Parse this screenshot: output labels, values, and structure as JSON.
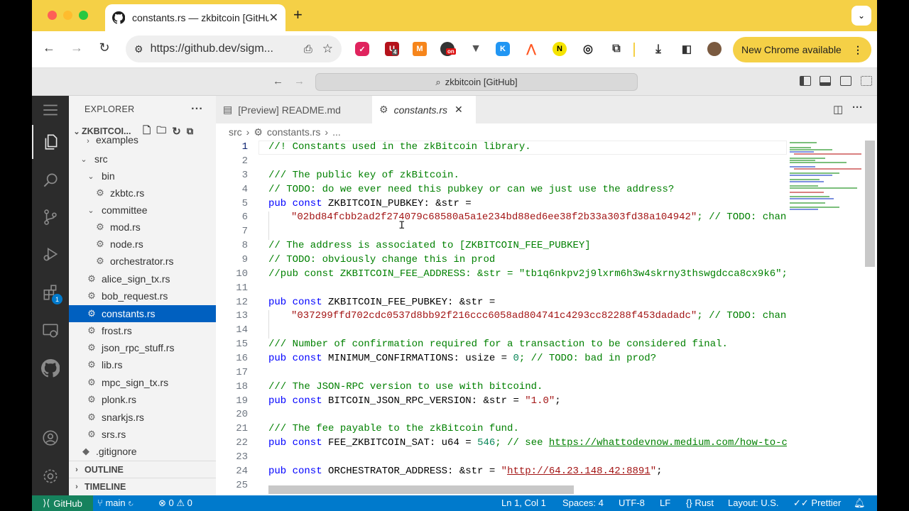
{
  "browser": {
    "tab_title": "constants.rs — zkbitcoin [GitHub]",
    "url": "https://github.dev/sigm...",
    "new_chrome": "New Chrome available",
    "ext_badge_1": "4",
    "ext_badge_2": "on"
  },
  "vscode": {
    "command_center": "zkbitcoin [GitHub]",
    "explorer_title": "EXPLORER",
    "root_folder": "ZKBITCOI...",
    "tree": [
      {
        "label": "examples",
        "kind": "folder"
      },
      {
        "label": "src",
        "kind": "folder"
      },
      {
        "label": "bin",
        "kind": "folder"
      },
      {
        "label": "zkbtc.rs",
        "kind": "file"
      },
      {
        "label": "committee",
        "kind": "folder"
      },
      {
        "label": "mod.rs",
        "kind": "file"
      },
      {
        "label": "node.rs",
        "kind": "file"
      },
      {
        "label": "orchestrator.rs",
        "kind": "file"
      },
      {
        "label": "alice_sign_tx.rs",
        "kind": "file"
      },
      {
        "label": "bob_request.rs",
        "kind": "file"
      },
      {
        "label": "constants.rs",
        "kind": "file"
      },
      {
        "label": "frost.rs",
        "kind": "file"
      },
      {
        "label": "json_rpc_stuff.rs",
        "kind": "file"
      },
      {
        "label": "lib.rs",
        "kind": "file"
      },
      {
        "label": "mpc_sign_tx.rs",
        "kind": "file"
      },
      {
        "label": "plonk.rs",
        "kind": "file"
      },
      {
        "label": "snarkjs.rs",
        "kind": "file"
      },
      {
        "label": "srs.rs",
        "kind": "file"
      },
      {
        "label": ".gitignore",
        "kind": "file"
      }
    ],
    "outline": "OUTLINE",
    "timeline": "TIMELINE",
    "extensions_badge": "1",
    "tabs": [
      {
        "label": "[Preview] README.md"
      },
      {
        "label": "constants.rs"
      }
    ],
    "breadcrumb": {
      "seg1": "src",
      "seg2": "constants.rs",
      "seg3": "..."
    },
    "line_numbers": [
      "1",
      "2",
      "3",
      "4",
      "5",
      "6",
      "7",
      "8",
      "9",
      "10",
      "11",
      "12",
      "13",
      "14",
      "15",
      "16",
      "17",
      "18",
      "19",
      "20",
      "21",
      "22",
      "23",
      "24",
      "25"
    ],
    "code": {
      "l1": "//! Constants used in the zkBitcoin library.",
      "l3": "/// The public key of zkBitcoin.",
      "l4": "// TODO: do we ever need this pubkey or can we just use the address?",
      "l5_kw": "pub const",
      "l5_rest": " ZKBITCOIN_PUBKEY: &str =",
      "l6_str": "\"02bd84fcbb2ad2f274079c68580a5a1e234bd88ed6ee38f2b33a303fd38a104942\"",
      "l6_cm": "; // TODO: change th",
      "l8": "// The address is associated to [ZKBITCOIN_FEE_PUBKEY]",
      "l9": "// TODO: obviously change this in prod",
      "l10": "//pub const ZKBITCOIN_FEE_ADDRESS: &str = \"tb1q6nkpv2j9lxrm6h3w4skrny3thswgdcca8cx9k6\";",
      "l12_kw": "pub const",
      "l12_rest": " ZKBITCOIN_FEE_PUBKEY: &str =",
      "l13_str": "\"037299ffd702cdc0537d8bb92f216ccc6058ad804741c4293cc82288f453dadadc\"",
      "l13_cm": "; // TODO: change th",
      "l15": "/// Number of confirmation required for a transaction to be considered final.",
      "l16_kw": "pub const",
      "l16_rest": " MINIMUM_CONFIRMATIONS: usize = ",
      "l16_num": "0",
      "l16_cm": "; // TODO: bad in prod?",
      "l18": "/// The JSON-RPC version to use with bitcoind.",
      "l19_kw": "pub const",
      "l19_rest": " BITCOIN_JSON_RPC_VERSION: &str = ",
      "l19_str": "\"1.0\"",
      "l19_end": ";",
      "l21": "/// The fee payable to the zkBitcoin fund.",
      "l22_kw": "pub const",
      "l22_rest": " FEE_ZKBITCOIN_SAT: u64 = ",
      "l22_num": "546",
      "l22_cm": "; // see ",
      "l22_link": "https://whattodevnow.medium.com/how-to-calcul",
      "l24_kw": "pub const",
      "l24_rest": " ORCHESTRATOR_ADDRESS: &str = ",
      "l24_q1": "\"",
      "l24_link": "http://64.23.148.42:8891",
      "l24_q2": "\"",
      "l24_end": ";"
    },
    "status": {
      "remote": "GitHub",
      "branch": "main",
      "errors": "0",
      "warnings": "0",
      "position": "Ln 1, Col 1",
      "spaces": "Spaces: 4",
      "encoding": "UTF-8",
      "eol": "LF",
      "language": "Rust",
      "layout": "Layout: U.S.",
      "formatter": "Prettier"
    }
  },
  "colors": {
    "chrome_yellow": "#f5d046",
    "selection": "#0060c0",
    "statusbar": "#007acc",
    "remote": "#16825d"
  }
}
